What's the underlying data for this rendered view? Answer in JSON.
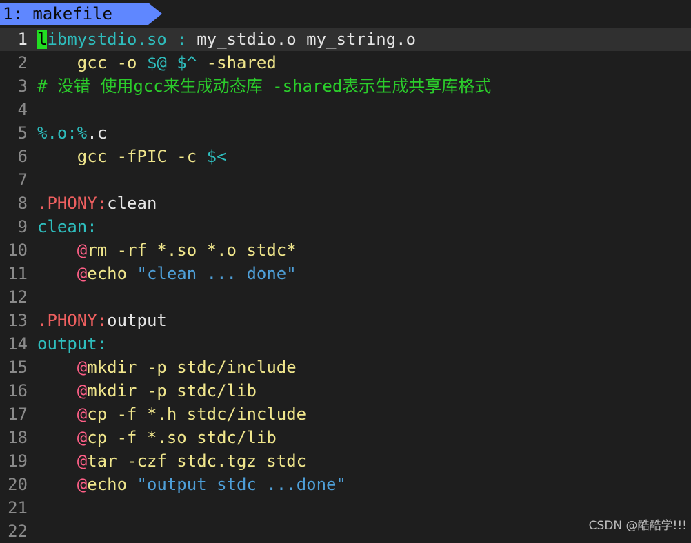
{
  "tab": {
    "label": "1: makefile"
  },
  "colors": {
    "tab_bg": "#5f87ff",
    "background": "#1e1e1e",
    "cursor": "#22dd22",
    "target": "#2ebdbd",
    "command": "#f0e68c",
    "comment": "#2bcc2b",
    "phony": "#ef6060",
    "at_sign": "#ff5f87",
    "string": "#4e9fd8"
  },
  "lines": [
    {
      "n": "1",
      "current": true,
      "tokens": [
        {
          "t": "l",
          "c": "cursor"
        },
        {
          "t": "ibmystdio.so",
          "c": "target"
        },
        {
          "t": " ",
          "c": "plain"
        },
        {
          "t": ":",
          "c": "target"
        },
        {
          "t": " my_stdio.o my_string.o",
          "c": "plain"
        }
      ]
    },
    {
      "n": "2",
      "tokens": [
        {
          "t": "    gcc -o ",
          "c": "cmd"
        },
        {
          "t": "$@",
          "c": "var"
        },
        {
          "t": " ",
          "c": "cmd"
        },
        {
          "t": "$^",
          "c": "var"
        },
        {
          "t": " -shared",
          "c": "cmd"
        }
      ]
    },
    {
      "n": "3",
      "tokens": [
        {
          "t": "# 没错 使用gcc来生成动态库 -shared表示生成共享库格式",
          "c": "comment"
        }
      ]
    },
    {
      "n": "4",
      "tokens": []
    },
    {
      "n": "5",
      "tokens": [
        {
          "t": "%.o:%",
          "c": "target"
        },
        {
          "t": ".c",
          "c": "plain"
        }
      ]
    },
    {
      "n": "6",
      "tokens": [
        {
          "t": "    gcc -fPIC -c ",
          "c": "cmd"
        },
        {
          "t": "$<",
          "c": "var"
        }
      ]
    },
    {
      "n": "7",
      "tokens": []
    },
    {
      "n": "8",
      "tokens": [
        {
          "t": ".PHONY:",
          "c": "phony"
        },
        {
          "t": "clean",
          "c": "plain"
        }
      ]
    },
    {
      "n": "9",
      "tokens": [
        {
          "t": "clean:",
          "c": "target"
        }
      ]
    },
    {
      "n": "10",
      "tokens": [
        {
          "t": "    ",
          "c": "cmd"
        },
        {
          "t": "@",
          "c": "at"
        },
        {
          "t": "rm -rf *.so *.o stdc*",
          "c": "cmd"
        }
      ]
    },
    {
      "n": "11",
      "tokens": [
        {
          "t": "    ",
          "c": "cmd"
        },
        {
          "t": "@",
          "c": "at"
        },
        {
          "t": "echo ",
          "c": "cmd"
        },
        {
          "t": "\"clean ... done\"",
          "c": "str"
        }
      ]
    },
    {
      "n": "12",
      "tokens": []
    },
    {
      "n": "13",
      "tokens": [
        {
          "t": ".PHONY:",
          "c": "phony"
        },
        {
          "t": "output",
          "c": "plain"
        }
      ]
    },
    {
      "n": "14",
      "tokens": [
        {
          "t": "output:",
          "c": "target"
        }
      ]
    },
    {
      "n": "15",
      "tokens": [
        {
          "t": "    ",
          "c": "cmd"
        },
        {
          "t": "@",
          "c": "at"
        },
        {
          "t": "mkdir -p stdc/include",
          "c": "cmd"
        }
      ]
    },
    {
      "n": "16",
      "tokens": [
        {
          "t": "    ",
          "c": "cmd"
        },
        {
          "t": "@",
          "c": "at"
        },
        {
          "t": "mkdir -p stdc/lib",
          "c": "cmd"
        }
      ]
    },
    {
      "n": "17",
      "tokens": [
        {
          "t": "    ",
          "c": "cmd"
        },
        {
          "t": "@",
          "c": "at"
        },
        {
          "t": "cp -f *.h stdc/include",
          "c": "cmd"
        }
      ]
    },
    {
      "n": "18",
      "tokens": [
        {
          "t": "    ",
          "c": "cmd"
        },
        {
          "t": "@",
          "c": "at"
        },
        {
          "t": "cp -f *.so stdc/lib",
          "c": "cmd"
        }
      ]
    },
    {
      "n": "19",
      "tokens": [
        {
          "t": "    ",
          "c": "cmd"
        },
        {
          "t": "@",
          "c": "at"
        },
        {
          "t": "tar -czf stdc.tgz stdc",
          "c": "cmd"
        }
      ]
    },
    {
      "n": "20",
      "tokens": [
        {
          "t": "    ",
          "c": "cmd"
        },
        {
          "t": "@",
          "c": "at"
        },
        {
          "t": "echo ",
          "c": "cmd"
        },
        {
          "t": "\"output stdc ...done\"",
          "c": "str"
        }
      ]
    },
    {
      "n": "21",
      "tokens": []
    },
    {
      "n": "22",
      "tokens": []
    }
  ],
  "watermark": "CSDN @酷酷学!!!"
}
